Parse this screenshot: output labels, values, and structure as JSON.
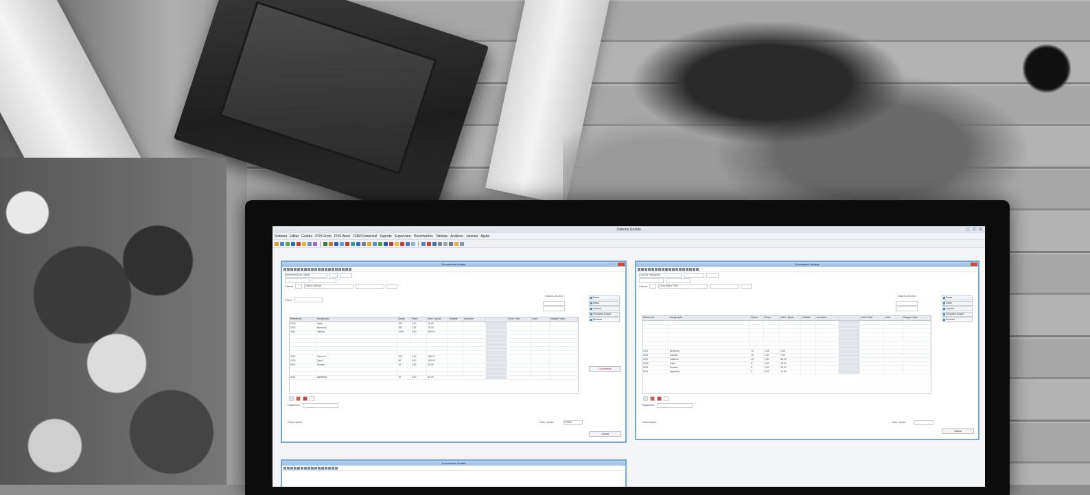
{
  "app": {
    "title": "Sistema Gestão",
    "window_controls": [
      "_",
      "□",
      "x"
    ]
  },
  "menu": [
    "Sistema",
    "Editar",
    "Gestão",
    "POS Front",
    "POS Back",
    "CRM/Comercial",
    "Suporte",
    "Supervisor",
    "Documentos",
    "Tabelas",
    "Análises",
    "Janelas",
    "Ajuda"
  ],
  "windows": {
    "left": {
      "title": "Documento Vendas",
      "doc_type": "Encomenda de Cliente",
      "client_label": "Cliente",
      "client_value": "Alberto Manuel",
      "date_label": "Data",
      "date_value": "11-06-2017",
      "price_label": "Preço",
      "headers": [
        "Referência",
        "Designação",
        "Quant.",
        "Preço",
        "Valor Líquido",
        "Unidade",
        "Armazém",
        "",
        "Custo Total",
        "Lucro",
        "Margem Valor"
      ],
      "rows": [
        [
          "1010",
          "Lápis",
          "100",
          "0,10",
          "10,00"
        ],
        [
          "2001",
          "Borracha",
          "300",
          "0,25",
          "75,00"
        ],
        [
          "3011",
          "Caneta",
          "1000",
          "0,50",
          "500,00"
        ],
        [
          "",
          "",
          "",
          "",
          ""
        ],
        [
          "",
          "",
          "",
          "",
          ""
        ],
        [
          "",
          "",
          "",
          "",
          ""
        ],
        [
          "",
          "",
          "",
          "",
          ""
        ],
        [
          "",
          "",
          "",
          "",
          ""
        ],
        [
          "4001",
          "Caderno",
          "100",
          "1,50",
          "150,00"
        ],
        [
          "4003",
          "Capa",
          "50",
          "3,00",
          "150,00"
        ],
        [
          "5001",
          "Dossier",
          "20",
          "2,50",
          "50,00"
        ],
        [
          "",
          "",
          "",
          "",
          ""
        ],
        [
          "",
          "",
          "",
          "",
          ""
        ],
        [
          "6001",
          "Agrafador",
          "10",
          "5,00",
          "50,00"
        ]
      ],
      "side_buttons": [
        "Fases",
        "Editar",
        "Imprimir",
        "Pesquisar Artigos",
        "Encerrar"
      ],
      "side_alert": "Documento",
      "observations_label": "Observações",
      "payment_label": "Pagamento",
      "total_label": "Total Líquido",
      "total_value": "0,0000",
      "bottom_button": "Gravar"
    },
    "right": {
      "title": "Documento Vendas",
      "doc_type": "Guia de Transporte",
      "client_label": "Cliente",
      "client_value": "Consumidor Final",
      "date_label": "Data",
      "date_value": "11-06-2017",
      "headers": [
        "Referência",
        "Designação",
        "Quant.",
        "Preço",
        "Valor Líquido",
        "Unidade",
        "Armazém",
        "",
        "Custo Total",
        "Lucro",
        "Margem Valor"
      ],
      "rows": [
        [
          "",
          "",
          "",
          "",
          ""
        ],
        [
          "",
          "",
          "",
          "",
          ""
        ],
        [
          "",
          "",
          "",
          "",
          ""
        ],
        [
          "",
          "",
          "",
          "",
          ""
        ],
        [
          "",
          "",
          "",
          "",
          ""
        ],
        [
          "",
          "",
          "",
          "",
          ""
        ],
        [
          "",
          "",
          "",
          "",
          ""
        ],
        [
          "2001",
          "Borracha",
          "10",
          "0,25",
          "2,50"
        ],
        [
          "3011",
          "Caneta",
          "15",
          "0,50",
          "7,50"
        ],
        [
          "4001",
          "Caderno",
          "20",
          "1,50",
          "30,00"
        ],
        [
          "4003",
          "Capa",
          "5",
          "3,00",
          "15,00"
        ],
        [
          "5001",
          "Dossier",
          "8",
          "2,50",
          "20,00"
        ],
        [
          "6001",
          "Agrafador",
          "2",
          "5,00",
          "10,00"
        ]
      ],
      "side_buttons": [
        "Fases",
        "Editar",
        "Imprimir",
        "Pesquisar Artigos",
        "Encerrar"
      ],
      "observations_label": "Observações",
      "payment_label": "Pagamento",
      "total_label": "Total Líquido",
      "bottom_button": "Gravar"
    },
    "bottom": {
      "title": "Documento Vendas"
    }
  }
}
